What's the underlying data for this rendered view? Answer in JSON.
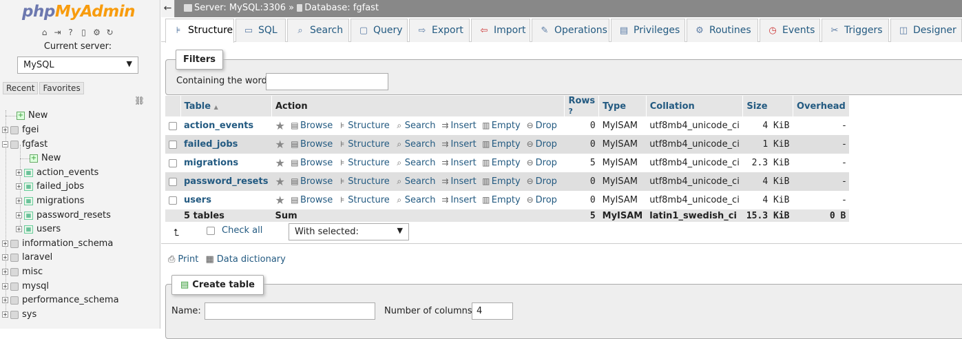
{
  "nav": {
    "logo_php": "php",
    "logo_myadmin": "MyAdmin",
    "current_server_label": "Current server:",
    "server_value": "MySQL",
    "recent_tab": "Recent",
    "favorites_tab": "Favorites",
    "tree": {
      "new": "New",
      "db_fgei": "fgei",
      "db_fgfast": "fgfast",
      "fgfast_new": "New",
      "t_action_events": "action_events",
      "t_failed_jobs": "failed_jobs",
      "t_migrations": "migrations",
      "t_password_resets": "password_resets",
      "t_users": "users",
      "db_information_schema": "information_schema",
      "db_laravel": "laravel",
      "db_misc": "misc",
      "db_mysql": "mysql",
      "db_performance_schema": "performance_schema",
      "db_sys": "sys"
    }
  },
  "breadcrumb": {
    "server": "Server: MySQL:3306",
    "sep": "»",
    "database": "Database: fgfast"
  },
  "tabs": {
    "structure": "Structure",
    "sql": "SQL",
    "search": "Search",
    "query": "Query",
    "export": "Export",
    "import": "Import",
    "operations": "Operations",
    "privileges": "Privileges",
    "routines": "Routines",
    "events": "Events",
    "triggers": "Triggers",
    "designer": "Designer"
  },
  "filters": {
    "legend": "Filters",
    "label": "Containing the word:",
    "value": ""
  },
  "table": {
    "headers": {
      "table": "Table",
      "action": "Action",
      "rows": "Rows",
      "type": "Type",
      "collation": "Collation",
      "size": "Size",
      "overhead": "Overhead"
    },
    "actions": {
      "browse": "Browse",
      "structure": "Structure",
      "search": "Search",
      "insert": "Insert",
      "empty": "Empty",
      "drop": "Drop"
    },
    "rows": [
      {
        "name": "action_events",
        "rows": "0",
        "type": "MyISAM",
        "collation": "utf8mb4_unicode_ci",
        "size": "4 KiB",
        "overhead": "-"
      },
      {
        "name": "failed_jobs",
        "rows": "0",
        "type": "MyISAM",
        "collation": "utf8mb4_unicode_ci",
        "size": "1 KiB",
        "overhead": "-"
      },
      {
        "name": "migrations",
        "rows": "5",
        "type": "MyISAM",
        "collation": "utf8mb4_unicode_ci",
        "size": "2.3 KiB",
        "overhead": "-"
      },
      {
        "name": "password_resets",
        "rows": "0",
        "type": "MyISAM",
        "collation": "utf8mb4_unicode_ci",
        "size": "4 KiB",
        "overhead": "-"
      },
      {
        "name": "users",
        "rows": "0",
        "type": "MyISAM",
        "collation": "utf8mb4_unicode_ci",
        "size": "4 KiB",
        "overhead": "-"
      }
    ],
    "summary": {
      "name": "5 tables",
      "action": "Sum",
      "rows": "5",
      "type": "MyISAM",
      "collation": "latin1_swedish_ci",
      "size": "15.3 KiB",
      "overhead": "0 B"
    }
  },
  "bulk": {
    "check_all": "Check all",
    "with_selected": "With selected:"
  },
  "links": {
    "print": "Print",
    "data_dictionary": "Data dictionary"
  },
  "create": {
    "legend": "Create table",
    "name_label": "Name:",
    "name_value": "",
    "columns_label": "Number of columns:",
    "columns_value": "4"
  }
}
